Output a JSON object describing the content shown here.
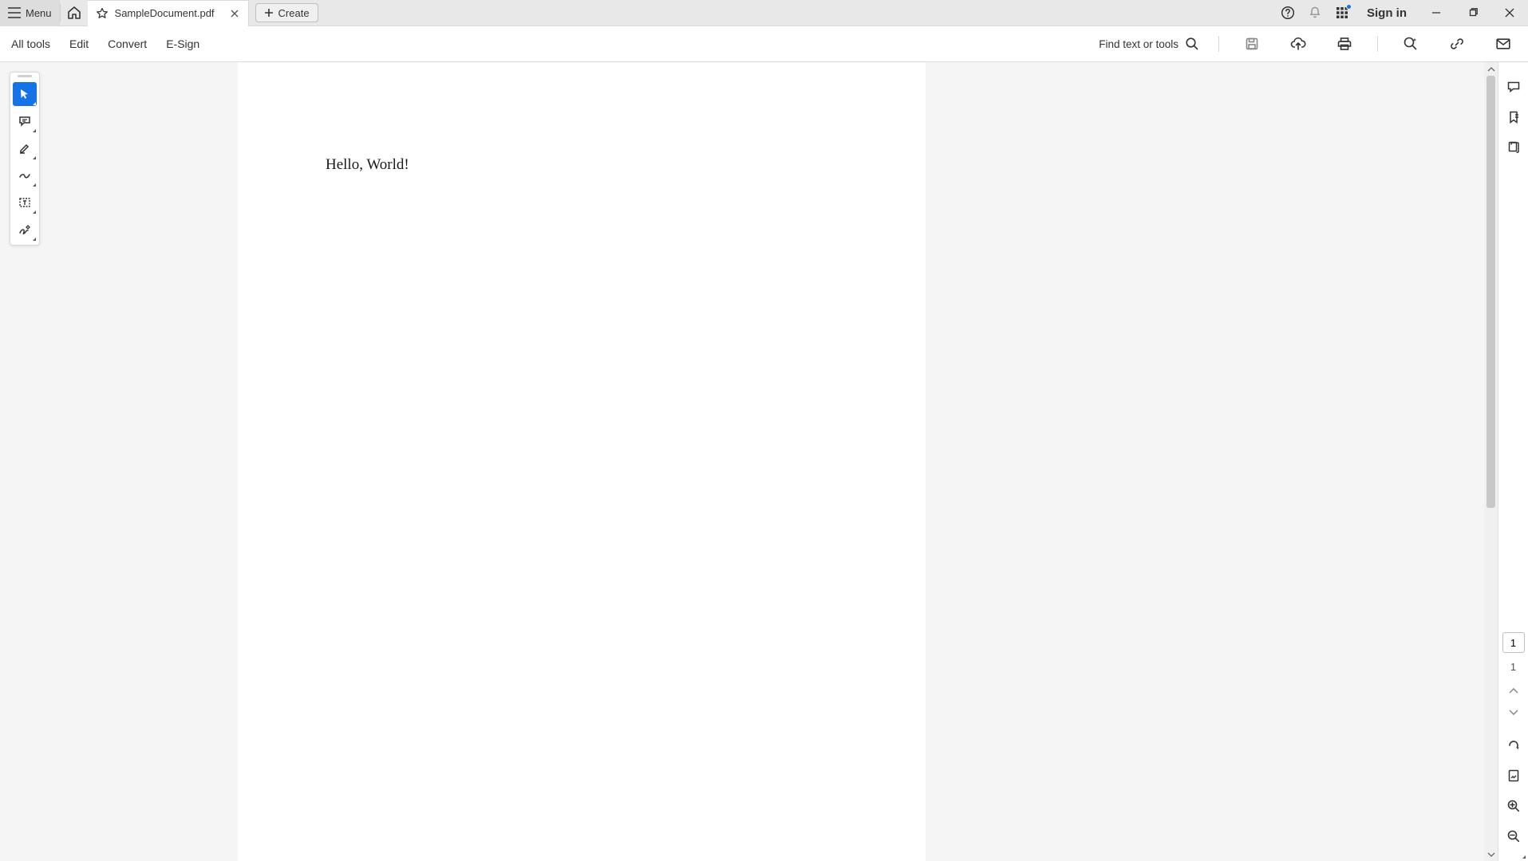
{
  "titlebar": {
    "menu_label": "Menu",
    "tab_title": "SampleDocument.pdf",
    "create_label": "Create",
    "signin_label": "Sign in"
  },
  "toolbar": {
    "items": [
      "All tools",
      "Edit",
      "Convert",
      "E-Sign"
    ],
    "find_label": "Find text or tools"
  },
  "document": {
    "content": "Hello, World!"
  },
  "nav": {
    "current_page": "1",
    "total_pages": "1"
  }
}
